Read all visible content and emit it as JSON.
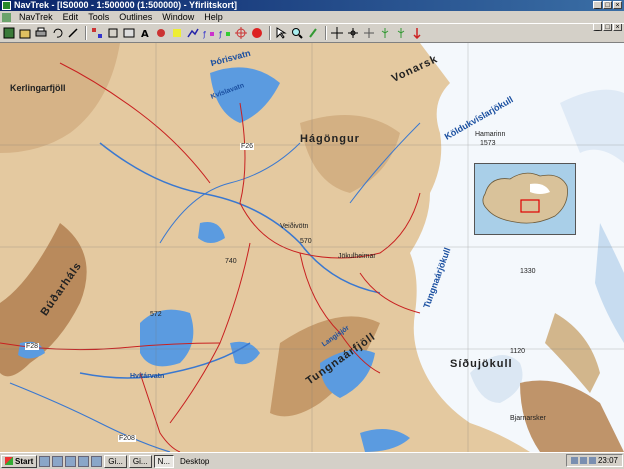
{
  "window": {
    "title": "NavTrek - [IS0000 - 1:500000 (1:500000) - Yfirlitskort]",
    "buttons": [
      "_",
      "□",
      "×"
    ]
  },
  "menubar": {
    "items": [
      "NavTrek",
      "Edit",
      "Tools",
      "Outlines",
      "Window",
      "Help"
    ]
  },
  "toolbar": {
    "icons": [
      "map-icon",
      "open-icon",
      "print-icon",
      "undo-icon",
      "redo-icon",
      "grid-icon",
      "layers-icon",
      "frame-icon",
      "text-icon",
      "route-icon",
      "waypoint-icon",
      "track-icon",
      "download-icon",
      "upload-icon",
      "gps-icon",
      "stop-icon",
      "pointer-icon",
      "zoom-icon",
      "measure-icon",
      "cross-icon",
      "cross2-icon",
      "cross3-icon",
      "tree-icon",
      "tree2-icon",
      "marker-icon"
    ]
  },
  "map": {
    "labels": {
      "thorisvatn": "Þórisvatn",
      "hagongur": "Hágöngur",
      "vonarsk": "Vonarsk",
      "koldukvislarjokull": "Köldukvíslarjökull",
      "tungnaarjokull": "Tungnaárjökull",
      "tungnaarfjoll": "Tungnaárfjöll",
      "sidujokull": "Síðujökull",
      "budarhals": "Búðarháls",
      "langisjor": "Langisjór",
      "kvislavatn": "Kvíslavatn",
      "kerlingarfjoll": "Kerlingarfjöll",
      "hvitarvatn": "Hvítárvatn",
      "bjarnarsker": "Bjarnarsker",
      "hamarinn": "Hamarinn",
      "f26": "F26",
      "f28": "F28",
      "f208": "F208",
      "e1573": "1573",
      "e1120": "1120",
      "e1330": "1330",
      "e572": "572",
      "e570": "570",
      "e740": "740",
      "fiskivotn": "Veiðivötn",
      "jokulheimar": "Jökulheimar"
    }
  },
  "taskbar": {
    "start": "Start",
    "tasks": [
      "Gi...",
      "Gi...",
      "N..."
    ],
    "desktop": "Desktop",
    "clock": "23:07"
  }
}
